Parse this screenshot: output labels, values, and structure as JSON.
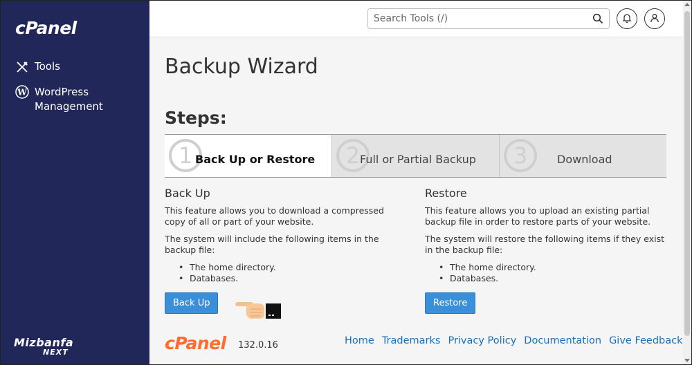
{
  "sidebar": {
    "logo": "cPanel",
    "items": [
      {
        "label": "Tools",
        "icon": "tools-icon"
      },
      {
        "label": "WordPress Management",
        "icon": "wordpress-icon"
      }
    ],
    "brand_line1": "Mizbanfa",
    "brand_line2": "NEXT"
  },
  "header": {
    "search_placeholder": "Search Tools (/)"
  },
  "main": {
    "title": "Backup Wizard",
    "steps_heading": "Steps:",
    "steps": [
      {
        "number": "1",
        "label": "Back Up or Restore"
      },
      {
        "number": "2",
        "label": "Full or Partial Backup"
      },
      {
        "number": "3",
        "label": "Download"
      }
    ],
    "backup": {
      "heading": "Back Up",
      "desc1": "This feature allows you to download a compressed copy of all or part of your website.",
      "desc2": "The system will include the following items in the backup file:",
      "items": [
        "The home directory.",
        "Databases."
      ],
      "button": "Back Up"
    },
    "restore": {
      "heading": "Restore",
      "desc1": "This feature allows you to upload an existing partial backup file in order to restore parts of your website.",
      "desc2": "The system will restore the following items if they exist in the backup file:",
      "items": [
        "The home directory.",
        "Databases."
      ],
      "button": "Restore"
    }
  },
  "footer": {
    "logo": "cPanel",
    "version": "132.0.16",
    "links": [
      "Home",
      "Trademarks",
      "Privacy Policy",
      "Documentation",
      "Give Feedback"
    ]
  },
  "colors": {
    "sidebar_bg": "#22275a",
    "accent": "#3a8fd9",
    "link": "#1b6fb8",
    "footer_logo": "#ff6c2c"
  }
}
